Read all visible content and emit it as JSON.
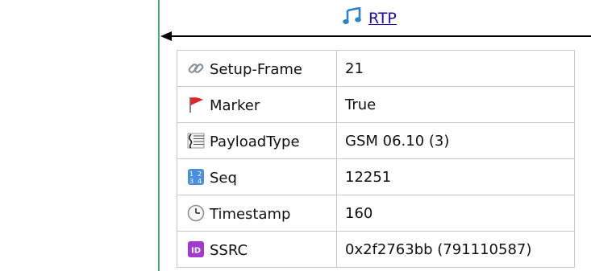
{
  "header": {
    "protocol_label": "RTP",
    "protocol_icon": "music-note-icon"
  },
  "rows": [
    {
      "icon": "link-icon",
      "key": "Setup-Frame",
      "value": "21"
    },
    {
      "icon": "red-flag-icon",
      "key": "Marker",
      "value": "True"
    },
    {
      "icon": "sheet-music-icon",
      "key": "PayloadType",
      "value": "GSM 06.10 (3)"
    },
    {
      "icon": "number-keypad-icon",
      "key": "Seq",
      "value": "12251"
    },
    {
      "icon": "clock-icon",
      "key": "Timestamp",
      "value": "160"
    },
    {
      "icon": "id-badge-icon",
      "key": "SSRC",
      "value": "0x2f2763bb (791110587)"
    }
  ],
  "colors": {
    "lifeline": "#4caf7a",
    "link": "#1a0dab",
    "id_badge": "#a23ad0",
    "flag": "#e3242b",
    "keypad": "#4a90e2"
  }
}
